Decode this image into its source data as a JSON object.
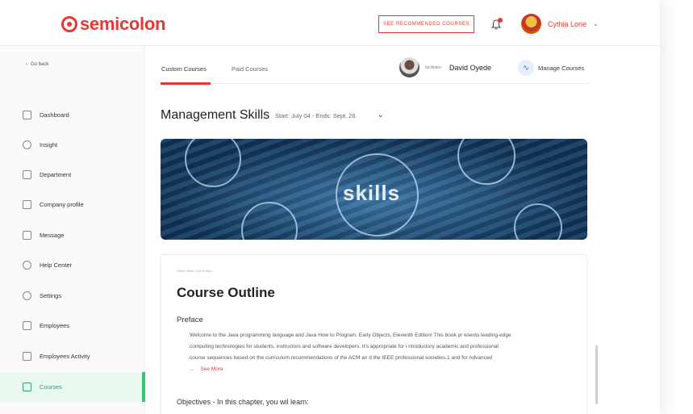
{
  "header": {
    "logo_text": "semicolon",
    "recommend_button": "SEE RECOMMENDED COURSES",
    "user_name": "Cythia Lorie",
    "user_chevron": "⌄"
  },
  "sidebar": {
    "go_back": "Go back",
    "items": [
      {
        "label": "Dashboard",
        "icon": "dashboard-icon"
      },
      {
        "label": "Insight",
        "icon": "insight-icon"
      },
      {
        "label": "Department",
        "icon": "department-icon"
      },
      {
        "label": "Company profile",
        "icon": "company-icon"
      },
      {
        "label": "Message",
        "icon": "message-icon"
      },
      {
        "label": "Help Center",
        "icon": "help-icon"
      },
      {
        "label": "Settings",
        "icon": "settings-icon"
      },
      {
        "label": "Employees",
        "icon": "employees-icon"
      },
      {
        "label": "Employees Activity",
        "icon": "activity-icon"
      },
      {
        "label": "Courses",
        "icon": "courses-icon",
        "active": true
      }
    ]
  },
  "tabs": {
    "custom": "Custom Courses",
    "paid": "Paid Courses"
  },
  "facilitator": {
    "label": "facilitator:",
    "name": "David Oyede"
  },
  "manage": {
    "label": "Manage Courses"
  },
  "course": {
    "title": "Management Skills",
    "dates": "Start: July 04 - Ends: Sept. 26",
    "banner_text": "skills"
  },
  "outline": {
    "edition": "Deitel deitel- 11th Edition",
    "title": "Course Outline",
    "preface_heading": "Preface",
    "preface_text": "Welcome to the Java programming language and Java How to Program, Early Objects, Eleventh Edition! This book pr esents leading-edge computing technologies for students, instructors and software developers. It’s appropriate for i ntroductory academic and professional course sequences based on the curriculum recommendations of the ACM an d the IEEE professional societies,1 and for Advanced ...",
    "see_more": "See More",
    "objectives": "Objectives - In this chapter, you wil learn:"
  },
  "colors": {
    "brand": "#e53935",
    "active": "#22a85a"
  }
}
